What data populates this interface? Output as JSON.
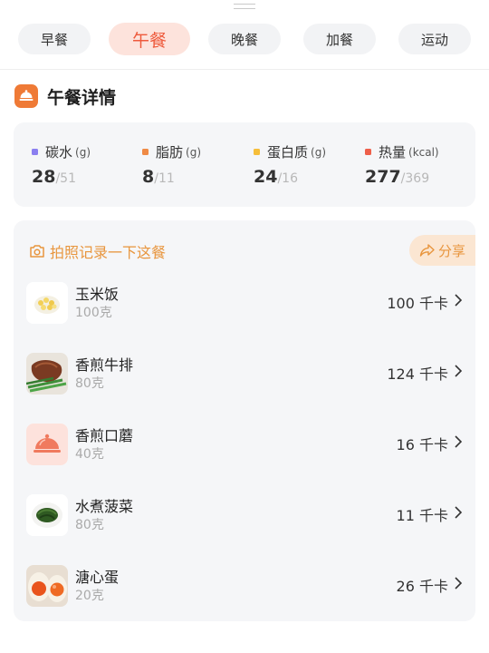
{
  "meal_tabs": [
    {
      "label": "早餐"
    },
    {
      "label": "午餐"
    },
    {
      "label": "晚餐"
    },
    {
      "label": "加餐"
    },
    {
      "label": "运动"
    }
  ],
  "active_tab": "午餐",
  "section": {
    "title": "午餐详情",
    "icon": "meal-cloche-icon"
  },
  "macros": [
    {
      "name": "碳水",
      "unit": "(g)",
      "value": "28",
      "target": "/51",
      "color": "#8b7ff0"
    },
    {
      "name": "脂肪",
      "unit": "(g)",
      "value": "8",
      "target": "/11",
      "color": "#ef8a45"
    },
    {
      "name": "蛋白质",
      "unit": "(g)",
      "value": "24",
      "target": "/16",
      "color": "#f6be3a"
    },
    {
      "name": "热量",
      "unit": "(kcal)",
      "value": "277",
      "target": "/369",
      "color": "#ee5f4a"
    }
  ],
  "photo_prompt": {
    "label": "拍照记录一下这餐",
    "icon": "camera-icon"
  },
  "share": {
    "label": "分享",
    "icon": "share-icon"
  },
  "foods": [
    {
      "name": "玉米饭",
      "weight": "100克",
      "calories": "100 千卡",
      "icon": "corn-rice-thumb"
    },
    {
      "name": "香煎牛排",
      "weight": "80克",
      "calories": "124 千卡",
      "icon": "steak-thumb"
    },
    {
      "name": "香煎口蘑",
      "weight": "40克",
      "calories": "16 千卡",
      "icon": "cloche-placeholder-thumb"
    },
    {
      "name": "水煮菠菜",
      "weight": "80克",
      "calories": "11 千卡",
      "icon": "spinach-thumb"
    },
    {
      "name": "溏心蛋",
      "weight": "20克",
      "calories": "26 千卡",
      "icon": "soft-boiled-egg-thumb"
    }
  ]
}
